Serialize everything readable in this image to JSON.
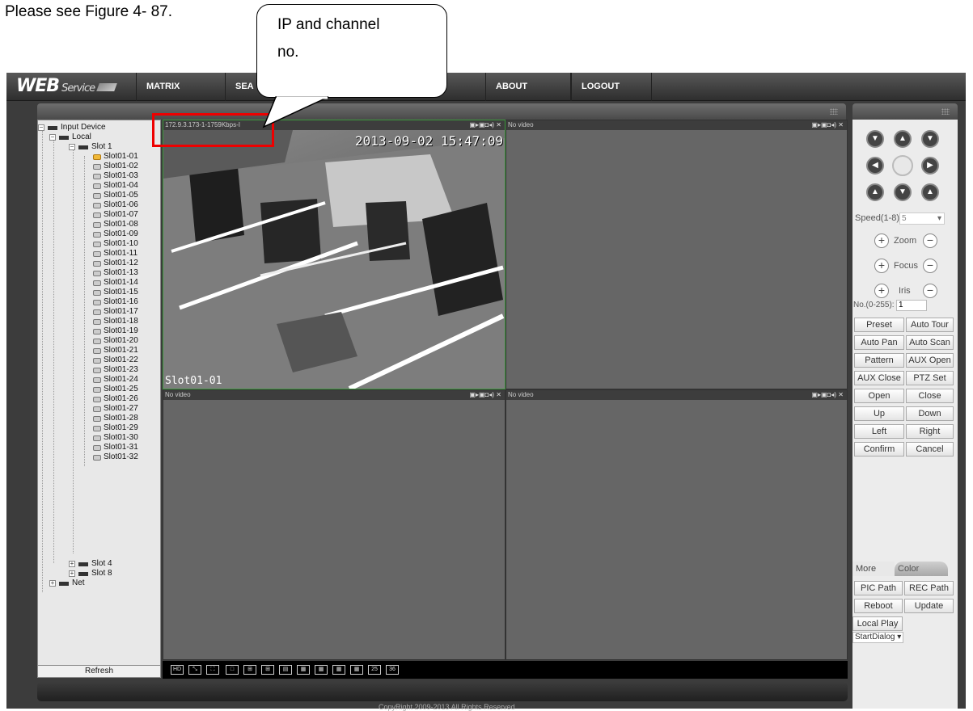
{
  "caption": "Please see Figure 4- 87.",
  "callout": {
    "line1": "IP and channel",
    "line2": "no."
  },
  "logo": {
    "main": "WEB",
    "sub": "Service"
  },
  "nav": {
    "matrix": "MATRIX CONTROL",
    "search_partial": "SEA",
    "about": "ABOUT",
    "logout": "LOGOUT"
  },
  "tree": {
    "root": "Input Device",
    "local": "Local",
    "slot1": "Slot 1",
    "channels": [
      "Slot01-01",
      "Slot01-02",
      "Slot01-03",
      "Slot01-04",
      "Slot01-05",
      "Slot01-06",
      "Slot01-07",
      "Slot01-08",
      "Slot01-09",
      "Slot01-10",
      "Slot01-11",
      "Slot01-12",
      "Slot01-13",
      "Slot01-14",
      "Slot01-15",
      "Slot01-16",
      "Slot01-17",
      "Slot01-18",
      "Slot01-19",
      "Slot01-20",
      "Slot01-21",
      "Slot01-22",
      "Slot01-23",
      "Slot01-24",
      "Slot01-25",
      "Slot01-26",
      "Slot01-27",
      "Slot01-28",
      "Slot01-29",
      "Slot01-30",
      "Slot01-31",
      "Slot01-32"
    ],
    "slot4": "Slot 4",
    "slot8": "Slot 8",
    "net": "Net",
    "refresh": "Refresh"
  },
  "videos": {
    "v1_title": "172.9.3.173-1-1759Kbps-I",
    "v1_time": "2013-09-02 15:47:09",
    "v1_channel": "Slot01-01",
    "no_video": "No video"
  },
  "layout_buttons": [
    "25",
    "36"
  ],
  "copyright": "CopyRight 2009-2013 All Rights Reserved",
  "ptz": {
    "speed_label": "Speed(1-8):",
    "speed_value": "5",
    "zoom": "Zoom",
    "focus": "Focus",
    "iris": "Iris",
    "no_label": "No.(0-255):",
    "no_value": "1",
    "buttons": [
      "Preset",
      "Auto Tour",
      "Auto Pan",
      "Auto Scan",
      "Pattern",
      "AUX Open",
      "AUX Close",
      "PTZ Set",
      "Open",
      "Close",
      "Up",
      "Down",
      "Left",
      "Right",
      "Confirm",
      "Cancel"
    ]
  },
  "tabs": {
    "more": "More",
    "color": "Color"
  },
  "more": {
    "pic": "PIC Path",
    "rec": "REC Path",
    "reboot": "Reboot",
    "update": "Update",
    "local_play": "Local Play",
    "start": "StartDialog"
  }
}
